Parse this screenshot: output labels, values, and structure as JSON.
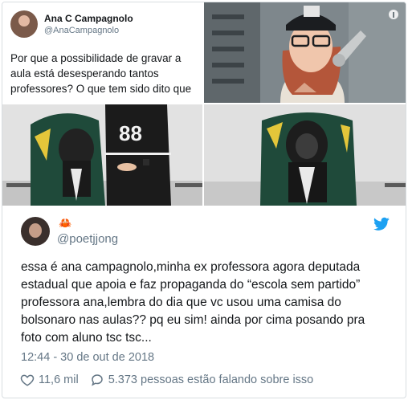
{
  "embedded_tweet": {
    "name": "Ana C Campagnolo",
    "handle": "@AnaCampagnolo",
    "text": "Por que a possibilidade de gravar a aula está desesperando tantos professores? O que tem sido dito que"
  },
  "tweet": {
    "emoji": "🦀",
    "handle": "@poetjjong",
    "text": "essa é ana campagnolo,minha ex professora agora deputada\nestadual que apoia e faz propaganda do “escola sem partido”\nprofessora ana,lembra do dia que vc usou uma camisa do\nbolsonaro nas aulas?? pq eu sim! ainda por cima posando pra\nfoto com aluno tsc tsc...",
    "timestamp": "12:44 - 30 de out de 2018",
    "likes": "11,6 mil",
    "replies": "5.373 pessoas estão falando sobre isso"
  },
  "icons": {
    "brand": "twitter-bird-icon",
    "like": "heart-icon",
    "reply": "speech-bubble-icon",
    "info": "info-icon"
  },
  "colors": {
    "twitter_blue": "#1da1f2",
    "text": "#14171a",
    "muted": "#657786",
    "border": "#d8dde1"
  }
}
